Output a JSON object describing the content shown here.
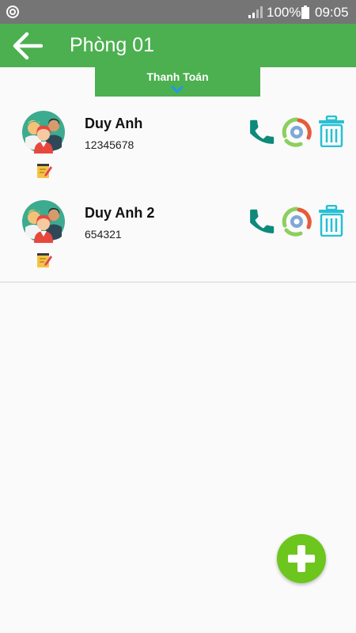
{
  "status_bar": {
    "sync_icon": "sync-icon",
    "signal_icon": "signal-icon",
    "battery": "100%",
    "time": "09:05"
  },
  "app_bar": {
    "back_icon": "arrow-left-icon",
    "title": "Phòng 01",
    "background": "#4caf50"
  },
  "payment_tab": {
    "label": "Thanh Toán",
    "icon": "chevron-down-icon"
  },
  "contacts": [
    {
      "name": "Duy Anh",
      "phone": "12345678"
    },
    {
      "name": "Duy Anh 2",
      "phone": "654321"
    }
  ],
  "row_actions": [
    "phone-icon",
    "sync-settings-icon",
    "trash-icon"
  ],
  "colors": {
    "accent": "#4caf50",
    "call": "#0e8a7a",
    "trash": "#26c0d3",
    "fab": "#6cc61e"
  },
  "fab": {
    "icon": "plus-icon"
  }
}
